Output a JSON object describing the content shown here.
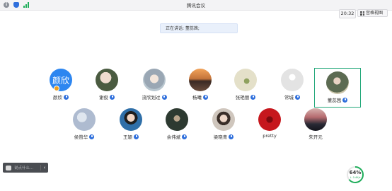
{
  "window": {
    "title": "腾讯会议"
  },
  "toolbar": {
    "timer": "20:32",
    "view_label": "宫格视图"
  },
  "speaking": {
    "text": "正在讲话: 董蕊茜;"
  },
  "participants": [
    {
      "name": "颜欣",
      "avatar_text": "颜欣",
      "avatar_color": "#2d86f0",
      "muted": false,
      "active": false
    },
    {
      "name": "谢俊",
      "avatar_color": "#6b7a5a",
      "active": false
    },
    {
      "name": "流欣划过",
      "avatar_color": "#9aa7b4",
      "active": false
    },
    {
      "name": "杨曦",
      "avatar_color": "#b06a3a",
      "active": false
    },
    {
      "name": "张艳丽",
      "avatar_color": "#d8d4bf",
      "active": false
    },
    {
      "name": "常城",
      "avatar_color": "#d9d9d9",
      "active": false
    },
    {
      "name": "董蕊茜",
      "avatar_color": "#6f7b66",
      "active": true
    },
    {
      "name": "侯赞华",
      "avatar_color": "#aebbd0",
      "active": false
    },
    {
      "name": "王颖",
      "avatar_color": "#2f6fa8",
      "active": false
    },
    {
      "name": "余伟斌",
      "avatar_color": "#2d3a31",
      "active": false
    },
    {
      "name": "梁晓青",
      "avatar_color": "#8a7d73",
      "active": false
    },
    {
      "name": "pretty",
      "avatar_color": "#c6171d",
      "active": false
    },
    {
      "name": "朱开元",
      "avatar_color": "#b56a6e",
      "active": false
    }
  ],
  "chat": {
    "placeholder": "说点什么...",
    "collapse_glyph": "‹"
  },
  "network": {
    "percent": "64%",
    "speed": "↓ 0.4K/s"
  },
  "colors": {
    "accent": "#2f6fdc",
    "active_border": "#23a87a",
    "network_ok": "#1fae5b"
  }
}
